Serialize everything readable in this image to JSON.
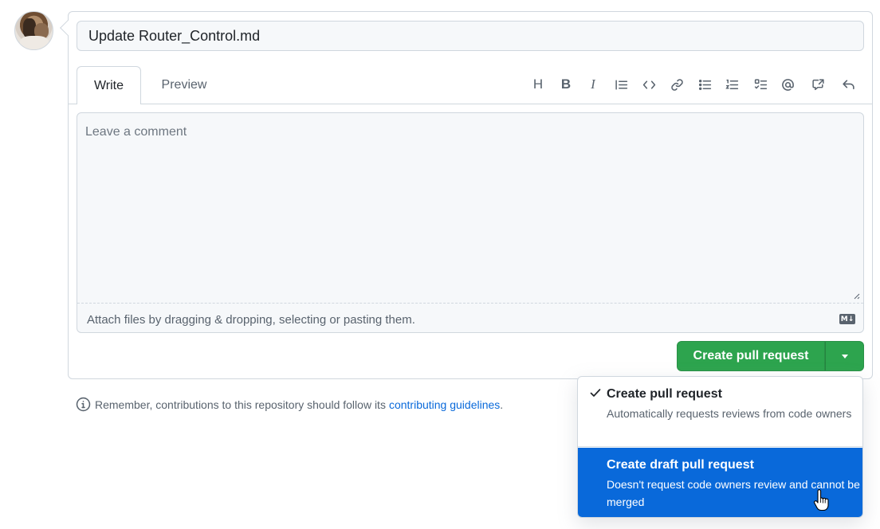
{
  "title_input": {
    "value": "Update Router_Control.md"
  },
  "tabs": [
    {
      "label": "Write",
      "active": true
    },
    {
      "label": "Preview",
      "active": false
    }
  ],
  "toolbar": {
    "icons": [
      "heading-icon",
      "bold-icon",
      "italic-icon",
      "quote-icon",
      "code-icon",
      "link-icon",
      "bulleted-list-icon",
      "numbered-list-icon",
      "task-list-icon",
      "mention-icon",
      "cross-reference-icon",
      "reply-icon"
    ],
    "heading": "H",
    "bold": "B",
    "italic": "I"
  },
  "comment": {
    "placeholder": "Leave a comment",
    "attach_text": "Attach files by dragging & dropping, selecting or pasting them.",
    "markdown_badge": "M↓"
  },
  "submit": {
    "label": "Create pull request",
    "color": "#2da44e"
  },
  "notice": {
    "text": "Remember, contributions to this repository should follow its",
    "link": "contributing guidelines",
    "suffix": "."
  },
  "dropdown": {
    "items": [
      {
        "title": "Create pull request",
        "description": "Automatically requests reviews from code owners",
        "selected": true
      },
      {
        "title": "Create draft pull request",
        "description": "Doesn't request code owners review and cannot be merged",
        "highlighted": true,
        "highlight_color": "#0969da"
      }
    ]
  }
}
